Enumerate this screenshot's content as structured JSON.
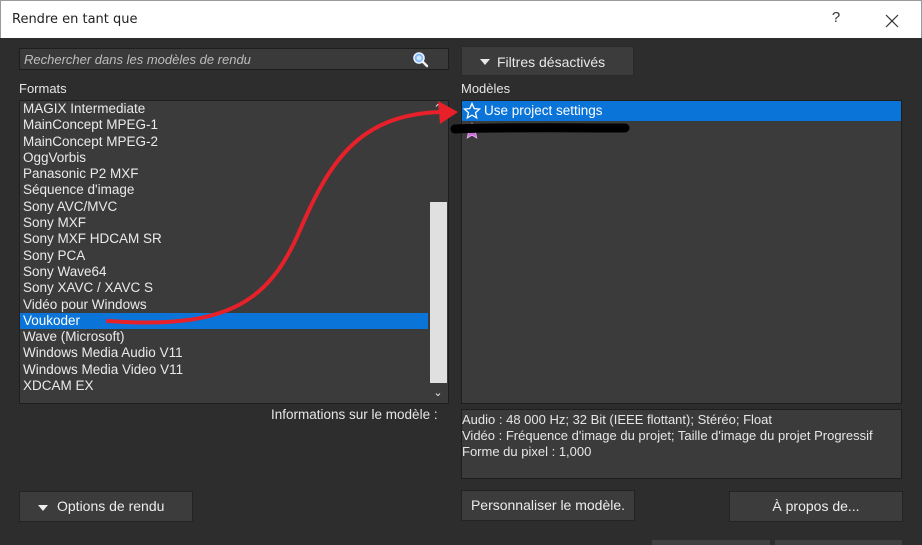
{
  "window": {
    "title": "Rendre en tant que",
    "help": "?"
  },
  "search": {
    "placeholder": "Rechercher dans les modèles de rendu",
    "icon": "search-icon"
  },
  "filter_button": {
    "label": "Filtres désactivés"
  },
  "formats": {
    "label": "Formats",
    "items": [
      "MAGIX Intermediate",
      "MainConcept MPEG-1",
      "MainConcept MPEG-2",
      "OggVorbis",
      "Panasonic P2 MXF",
      "Séquence d'image",
      "Sony AVC/MVC",
      "Sony MXF",
      "Sony MXF HDCAM SR",
      "Sony PCA",
      "Sony Wave64",
      "Sony XAVC / XAVC S",
      "Vidéo pour Windows",
      "Voukoder",
      "Wave (Microsoft)",
      "Windows Media Audio V11",
      "Windows Media Video V11",
      "XDCAM EX"
    ],
    "selected": "Voukoder"
  },
  "models": {
    "label": "Modèles",
    "items": [
      {
        "label": "Use project settings",
        "selected": true,
        "icon": "star-outline-icon"
      },
      {
        "label": "",
        "selected": false,
        "icon": "star-purple-icon"
      }
    ]
  },
  "model_info": {
    "label": "Informations sur le modèle :",
    "lines": [
      "Audio : 48 000 Hz; 32 Bit (IEEE flottant); Stéréo; Float",
      "Vidéo : Fréquence d'image du projet; Taille d'image du projet Progressif",
      "Forme du pixel : 1,000"
    ]
  },
  "buttons": {
    "render_options": "Options de rendu",
    "customize_template": "Personnaliser le modèle.",
    "about": "À propos de..."
  },
  "colors": {
    "background": "#2d2d2d",
    "list_bg": "#3b3b3b",
    "selection": "#0a74d8",
    "annotation_arrow": "#e8202a"
  }
}
